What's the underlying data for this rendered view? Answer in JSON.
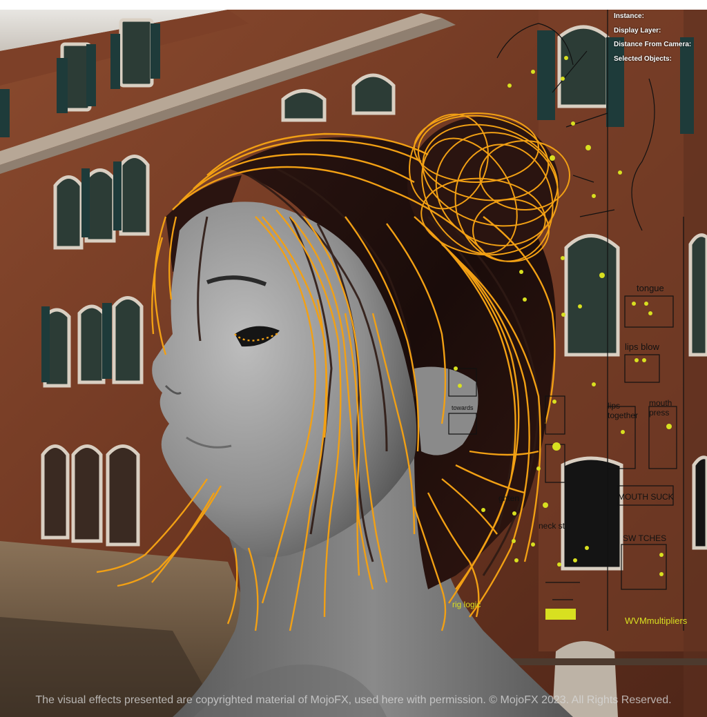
{
  "hud": {
    "instance_label": "Instance:",
    "display_layer_label": "Display Layer:",
    "distance_label": "Distance From Camera:",
    "selected_label": "Selected Objects:"
  },
  "rig_labels": {
    "tongue": "tongue",
    "lips_blow": "lips blow",
    "lips_together_1": "lips",
    "lips_together_2": "together",
    "mouth_press_1": "mouth",
    "mouth_press_2": "press",
    "mouth_suck": "MOUTH SUCK",
    "switches": "SW TCHES",
    "neck": "neck st",
    "tighten": "ghten",
    "towards": "towards",
    "rig_logic": "rig logic",
    "multipliers": "WVMmultipliers"
  },
  "copyright": "The visual effects presented are copyrighted material of MojoFX, used here with permission. © MojoFX 2023. All Rights Reserved.",
  "colors": {
    "guide_curves": "#f2a014",
    "control_points": "#d8e020",
    "rig_lines": "#111111",
    "skin": "#9a9a9a",
    "brick": "#7a4129"
  }
}
